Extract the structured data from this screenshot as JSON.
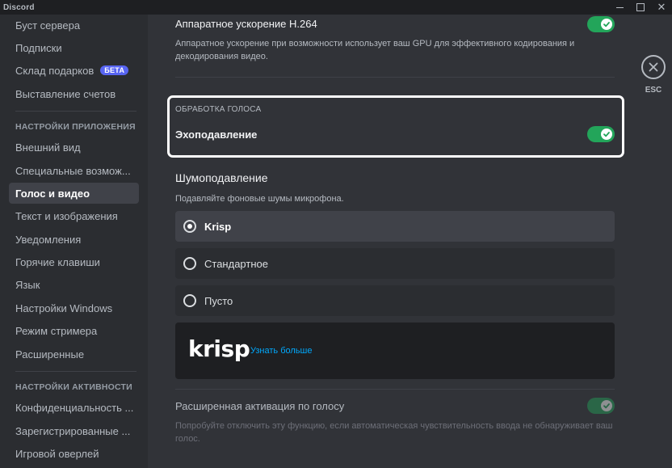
{
  "window": {
    "title": "Discord",
    "controls": [
      "minimize",
      "maximize",
      "close"
    ]
  },
  "sidebar": {
    "items_top": [
      {
        "label": "Буст сервера"
      },
      {
        "label": "Подписки"
      },
      {
        "label": "Склад подарков",
        "badge": "БЕТА"
      },
      {
        "label": "Выставление счетов"
      }
    ],
    "app_settings_header": "НАСТРОЙКИ ПРИЛОЖЕНИЯ",
    "app_items": [
      {
        "label": "Внешний вид"
      },
      {
        "label": "Специальные возмож..."
      },
      {
        "label": "Голос и видео",
        "selected": true
      },
      {
        "label": "Текст и изображения"
      },
      {
        "label": "Уведомления"
      },
      {
        "label": "Горячие клавиши"
      },
      {
        "label": "Язык"
      },
      {
        "label": "Настройки Windows"
      },
      {
        "label": "Режим стримера"
      },
      {
        "label": "Расширенные"
      }
    ],
    "activity_header": "НАСТРОЙКИ АКТИВНОСТИ",
    "activity_items": [
      {
        "label": "Конфиденциальность ..."
      },
      {
        "label": "Зарегистрированные ..."
      },
      {
        "label": "Игровой оверлей"
      }
    ]
  },
  "main": {
    "hw_accel": {
      "title": "Аппаратное ускорение H.264",
      "description": "Аппаратное ускорение при возможности использует ваш GPU для эффективного кодирования и декодирования видео.",
      "enabled": true
    },
    "voice_processing": {
      "section_label": "ОБРАБОТКА ГОЛОСА",
      "echo_title": "Эхоподавление",
      "enabled": true
    },
    "noise_suppression": {
      "title": "Шумоподавление",
      "description": "Подавляйте фоновые шумы микрофона.",
      "options": [
        {
          "label": "Krisp",
          "selected": true
        },
        {
          "label": "Стандартное",
          "selected": false
        },
        {
          "label": "Пусто",
          "selected": false
        }
      ],
      "krisp_logo": "krisp",
      "learn_more": "Узнать больше"
    },
    "advanced_vad": {
      "title": "Расширенная активация по голосу",
      "description": "Попробуйте отключить эту функцию, если автоматическая чувствительность ввода не обнаруживает ваш голос.",
      "enabled": true,
      "disabled_state": true
    },
    "close": {
      "label": "ESC"
    }
  },
  "colors": {
    "background": "#313338",
    "sidebar": "#2b2d31",
    "toggle_on": "#23a55a",
    "accent": "#5865f2",
    "link": "#00a8fc"
  }
}
